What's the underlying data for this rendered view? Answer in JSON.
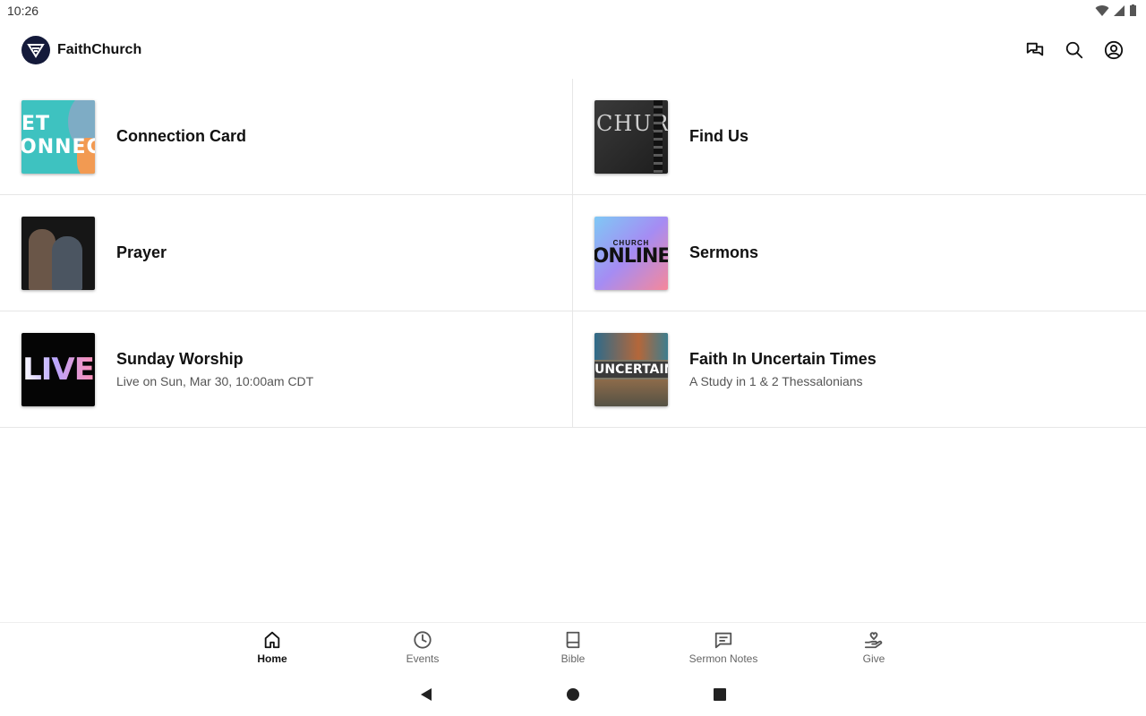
{
  "status_bar": {
    "time": "10:26"
  },
  "app": {
    "title": "FaithChurch"
  },
  "tiles": [
    {
      "title": "Connection Card",
      "subtitle": "",
      "thumb_text": [
        "ET",
        "ONNECTE"
      ]
    },
    {
      "title": "Find Us",
      "subtitle": "",
      "thumb_text": [
        "CHURCH"
      ]
    },
    {
      "title": "Prayer",
      "subtitle": "",
      "thumb_text": []
    },
    {
      "title": "Sermons",
      "subtitle": "",
      "thumb_text": [
        "CHURCH",
        "ONLINE"
      ]
    },
    {
      "title": "Sunday Worship",
      "subtitle": "Live on Sun, Mar 30, 10:00am CDT",
      "thumb_text": [
        "LIVE"
      ]
    },
    {
      "title": "Faith In Uncertain Times",
      "subtitle": "A Study in 1 & 2 Thessalonians",
      "thumb_text": [
        "UNCERTAIN"
      ]
    }
  ],
  "bottom_nav": [
    {
      "label": "Home",
      "icon": "home-icon",
      "active": true
    },
    {
      "label": "Events",
      "icon": "clock-icon",
      "active": false
    },
    {
      "label": "Bible",
      "icon": "book-icon",
      "active": false
    },
    {
      "label": "Sermon Notes",
      "icon": "notes-icon",
      "active": false
    },
    {
      "label": "Give",
      "icon": "give-icon",
      "active": false
    }
  ],
  "colors": {
    "logo_bg": "#141a3a",
    "divider": "#e6e6e6",
    "active_text": "#111111",
    "inactive_text": "#666666"
  }
}
